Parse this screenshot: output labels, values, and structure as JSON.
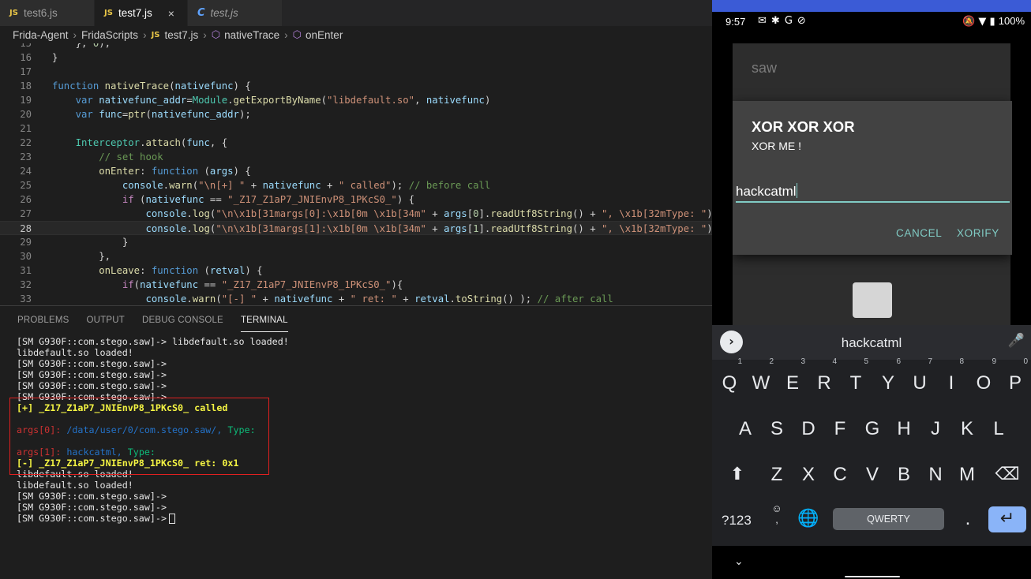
{
  "vscode": {
    "tabs": [
      {
        "icon": "JS",
        "label": "test6.js"
      },
      {
        "icon": "JS",
        "label": "test7.js",
        "close": "×"
      },
      {
        "icon": "C",
        "label": "test.js"
      }
    ],
    "breadcrumb": [
      "Frida-Agent",
      "FridaScripts",
      "test7.js",
      "nativeTrace",
      "onEnter"
    ],
    "breadcrumb_js_icon": "JS",
    "line_numbers": [
      "15",
      "16",
      "17",
      "18",
      "19",
      "20",
      "21",
      "22",
      "23",
      "24",
      "25",
      "26",
      "27",
      "28",
      "29",
      "30",
      "31",
      "32",
      "33"
    ],
    "panel_tabs": [
      "PROBLEMS",
      "OUTPUT",
      "DEBUG CONSOLE",
      "TERMINAL"
    ],
    "terminal": {
      "lines": [
        "[SM G930F::com.stego.saw]-> libdefault.so loaded!",
        "libdefault.so loaded!",
        "[SM G930F::com.stego.saw]->",
        "[SM G930F::com.stego.saw]->",
        "[SM G930F::com.stego.saw]->",
        "[SM G930F::com.stego.saw]->",
        "[+] _Z17_Z1aP7_JNIEnvP8_1PKcS0_ called",
        "",
        "args[0]: /data/user/0/com.stego.saw/, Type:",
        "",
        "args[1]: hackcatml, Type:",
        "[-] _Z17_Z1aP7_JNIEnvP8_1PKcS0_ ret: 0x1",
        "libdefault.so loaded!",
        "libdefault.so loaded!",
        "[SM G930F::com.stego.saw]->",
        "[SM G930F::com.stego.saw]->",
        "[SM G930F::com.stego.saw]->"
      ],
      "args0_label": "args[0]:",
      "args0_value": "/data/user/0/com.stego.saw/,",
      "args0_type": "Type:",
      "args1_label": "args[1]:",
      "args1_value": "hackcatml,",
      "args1_type": "Type:"
    },
    "colors": {
      "highlight_box": "#e02020",
      "terminal_yellow": "#f5f543",
      "terminal_red": "#cd3131",
      "terminal_blue": "#2472c8"
    }
  },
  "android": {
    "status": {
      "time": "9:57",
      "battery": "100%",
      "left_icons": "sms-icon debug-icon google-icon vpn-icon",
      "right_icons": "mute-icon wifi-icon battery-icon"
    },
    "background_app_text": "saw",
    "dialog": {
      "title": "XOR XOR XOR",
      "message": "XOR ME !",
      "input_value": "hackcatml",
      "cancel": "CANCEL",
      "confirm": "XORIFY",
      "accent_color": "#80cbc4"
    },
    "keyboard": {
      "suggestion": "hackcatml",
      "row1": [
        "Q",
        "W",
        "E",
        "R",
        "T",
        "Y",
        "U",
        "I",
        "O",
        "P"
      ],
      "row1_hints": [
        "1",
        "2",
        "3",
        "4",
        "5",
        "6",
        "7",
        "8",
        "9",
        "0"
      ],
      "row2": [
        "A",
        "S",
        "D",
        "F",
        "G",
        "H",
        "J",
        "K",
        "L"
      ],
      "row3": [
        "Z",
        "X",
        "C",
        "V",
        "B",
        "N",
        "M"
      ],
      "symbols_key": "?123",
      "emoji_comma": ",",
      "space_label": "QWERTY",
      "period": "."
    }
  }
}
